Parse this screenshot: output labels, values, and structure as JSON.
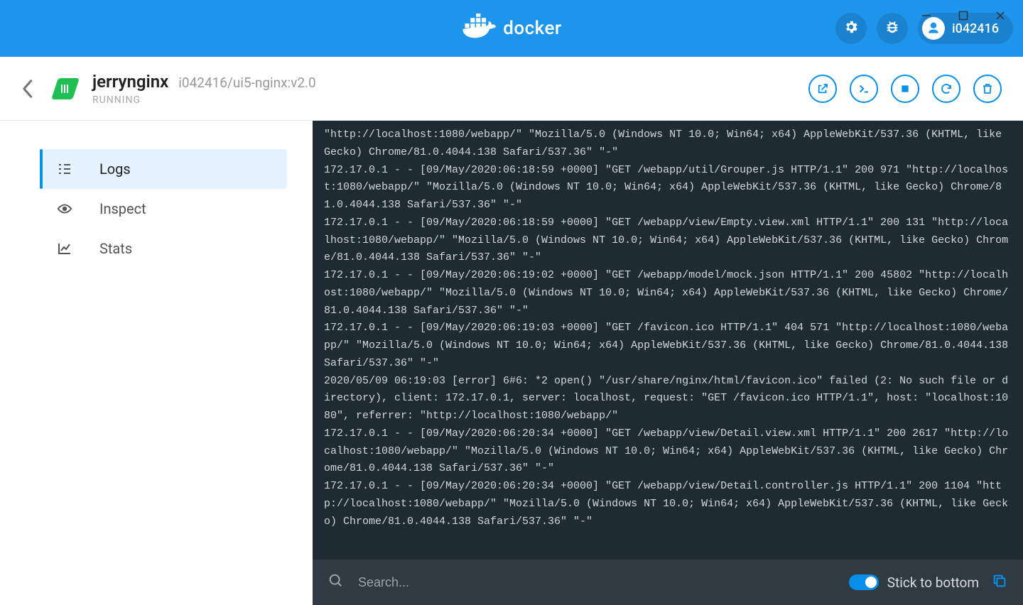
{
  "brand": "docker",
  "user": {
    "name": "i042416"
  },
  "container": {
    "name": "jerrynginx",
    "image": "i042416/ui5-nginx:v2.0",
    "status": "RUNNING"
  },
  "sidebar": {
    "items": [
      {
        "label": "Logs"
      },
      {
        "label": "Inspect"
      },
      {
        "label": "Stats"
      }
    ]
  },
  "search": {
    "placeholder": "Search..."
  },
  "stick_label": "Stick to bottom",
  "logs": [
    "\"http://localhost:1080/webapp/\" \"Mozilla/5.0 (Windows NT 10.0; Win64; x64) AppleWebKit/537.36 (KHTML, like Gecko) Chrome/81.0.4044.138 Safari/537.36\" \"-\"",
    "172.17.0.1 - - [09/May/2020:06:18:59 +0000] \"GET /webapp/util/Grouper.js HTTP/1.1\" 200 971 \"http://localhost:1080/webapp/\" \"Mozilla/5.0 (Windows NT 10.0; Win64; x64) AppleWebKit/537.36 (KHTML, like Gecko) Chrome/81.0.4044.138 Safari/537.36\" \"-\"",
    "172.17.0.1 - - [09/May/2020:06:18:59 +0000] \"GET /webapp/view/Empty.view.xml HTTP/1.1\" 200 131 \"http://localhost:1080/webapp/\" \"Mozilla/5.0 (Windows NT 10.0; Win64; x64) AppleWebKit/537.36 (KHTML, like Gecko) Chrome/81.0.4044.138 Safari/537.36\" \"-\"",
    "172.17.0.1 - - [09/May/2020:06:19:02 +0000] \"GET /webapp/model/mock.json HTTP/1.1\" 200 45802 \"http://localhost:1080/webapp/\" \"Mozilla/5.0 (Windows NT 10.0; Win64; x64) AppleWebKit/537.36 (KHTML, like Gecko) Chrome/81.0.4044.138 Safari/537.36\" \"-\"",
    "172.17.0.1 - - [09/May/2020:06:19:03 +0000] \"GET /favicon.ico HTTP/1.1\" 404 571 \"http://localhost:1080/webapp/\" \"Mozilla/5.0 (Windows NT 10.0; Win64; x64) AppleWebKit/537.36 (KHTML, like Gecko) Chrome/81.0.4044.138 Safari/537.36\" \"-\"",
    "2020/05/09 06:19:03 [error] 6#6: *2 open() \"/usr/share/nginx/html/favicon.ico\" failed (2: No such file or directory), client: 172.17.0.1, server: localhost, request: \"GET /favicon.ico HTTP/1.1\", host: \"localhost:1080\", referrer: \"http://localhost:1080/webapp/\"",
    "172.17.0.1 - - [09/May/2020:06:20:34 +0000] \"GET /webapp/view/Detail.view.xml HTTP/1.1\" 200 2617 \"http://localhost:1080/webapp/\" \"Mozilla/5.0 (Windows NT 10.0; Win64; x64) AppleWebKit/537.36 (KHTML, like Gecko) Chrome/81.0.4044.138 Safari/537.36\" \"-\"",
    "172.17.0.1 - - [09/May/2020:06:20:34 +0000] \"GET /webapp/view/Detail.controller.js HTTP/1.1\" 200 1104 \"http://localhost:1080/webapp/\" \"Mozilla/5.0 (Windows NT 10.0; Win64; x64) AppleWebKit/537.36 (KHTML, like Gecko) Chrome/81.0.4044.138 Safari/537.36\" \"-\""
  ]
}
